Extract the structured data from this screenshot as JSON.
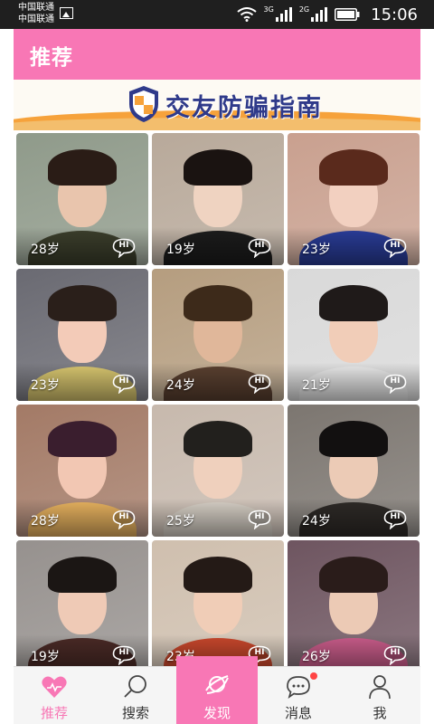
{
  "status_bar": {
    "carrier_1": "中国联通",
    "carrier_2": "中国联通",
    "network_1": "3G",
    "network_2": "2G",
    "time": "15:06"
  },
  "header": {
    "title": "推荐"
  },
  "banner": {
    "text": "交友防骗指南"
  },
  "profiles": [
    {
      "age": "28岁",
      "hi": "HI"
    },
    {
      "age": "19岁",
      "hi": "HI"
    },
    {
      "age": "23岁",
      "hi": "HI"
    },
    {
      "age": "23岁",
      "hi": "HI"
    },
    {
      "age": "24岁",
      "hi": "HI"
    },
    {
      "age": "21岁",
      "hi": "HI"
    },
    {
      "age": "28岁",
      "hi": "HI"
    },
    {
      "age": "25岁",
      "hi": "HI"
    },
    {
      "age": "24岁",
      "hi": "HI"
    },
    {
      "age": "19岁",
      "hi": "HI"
    },
    {
      "age": "23岁",
      "hi": "HI"
    },
    {
      "age": "26岁",
      "hi": "HI"
    }
  ],
  "tabs": [
    {
      "label": "推荐",
      "icon": "heart-icon",
      "active": true
    },
    {
      "label": "搜索",
      "icon": "search-icon",
      "active": false
    },
    {
      "label": "发现",
      "icon": "discover-icon",
      "active": false
    },
    {
      "label": "消息",
      "icon": "message-icon",
      "active": false
    },
    {
      "label": "我",
      "icon": "profile-icon",
      "active": false
    }
  ],
  "colors": {
    "accent_pink": "#f877b5",
    "banner_orange": "#f6a23b",
    "banner_text_blue": "#2f3a8a",
    "status_bar": "#1f1f1f"
  }
}
